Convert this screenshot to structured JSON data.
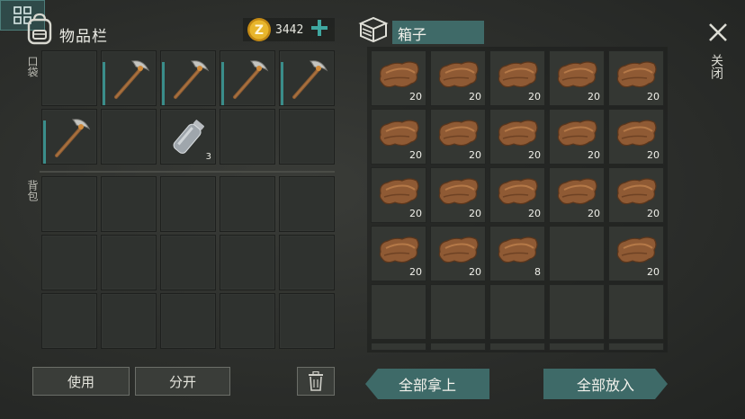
{
  "header": {
    "inventory_title": "物品栏",
    "coins": "3442",
    "box_title": "箱子",
    "close_label": "关闭",
    "icons": {
      "bag": "backpack-icon",
      "coin": "coin-icon",
      "add": "plus-icon",
      "box": "box-icon",
      "close": "close-icon"
    }
  },
  "inventory": {
    "pocket_label": "口袋",
    "backpack_label": "背包",
    "pocket_slots": [
      {
        "item": "",
        "qty": ""
      },
      {
        "item": "pickaxe",
        "qty": ""
      },
      {
        "item": "pickaxe",
        "qty": ""
      },
      {
        "item": "pickaxe",
        "qty": ""
      },
      {
        "item": "pickaxe",
        "qty": ""
      },
      {
        "item": "pickaxe",
        "qty": ""
      },
      {
        "item": "",
        "qty": ""
      },
      {
        "item": "bottle",
        "qty": "3"
      },
      {
        "item": "",
        "qty": ""
      },
      {
        "item": "",
        "qty": ""
      }
    ]
  },
  "box": {
    "slots": [
      {
        "item": "leather",
        "qty": "20"
      },
      {
        "item": "leather",
        "qty": "20"
      },
      {
        "item": "leather",
        "qty": "20"
      },
      {
        "item": "leather",
        "qty": "20"
      },
      {
        "item": "leather",
        "qty": "20"
      },
      {
        "item": "leather",
        "qty": "20"
      },
      {
        "item": "leather",
        "qty": "20"
      },
      {
        "item": "leather",
        "qty": "20"
      },
      {
        "item": "leather",
        "qty": "20"
      },
      {
        "item": "leather",
        "qty": "20"
      },
      {
        "item": "leather",
        "qty": "20"
      },
      {
        "item": "leather",
        "qty": "20"
      },
      {
        "item": "leather",
        "qty": "20"
      },
      {
        "item": "leather",
        "qty": "20"
      },
      {
        "item": "leather",
        "qty": "20"
      },
      {
        "item": "leather",
        "qty": "20"
      },
      {
        "item": "leather",
        "qty": "20"
      },
      {
        "item": "leather",
        "qty": "8"
      },
      {
        "item": "",
        "qty": ""
      },
      {
        "item": "leather",
        "qty": "20"
      }
    ]
  },
  "buttons": {
    "use": "使用",
    "split": "分开",
    "take_all": "全部拿上",
    "put_all": "全部放入",
    "trash_icon": "trash-icon",
    "sort_icon": "sort-grid-icon"
  },
  "colors": {
    "accent_teal": "#3e6a68",
    "durability": "#3a8d8a",
    "coin_gold": "#d9a520"
  }
}
